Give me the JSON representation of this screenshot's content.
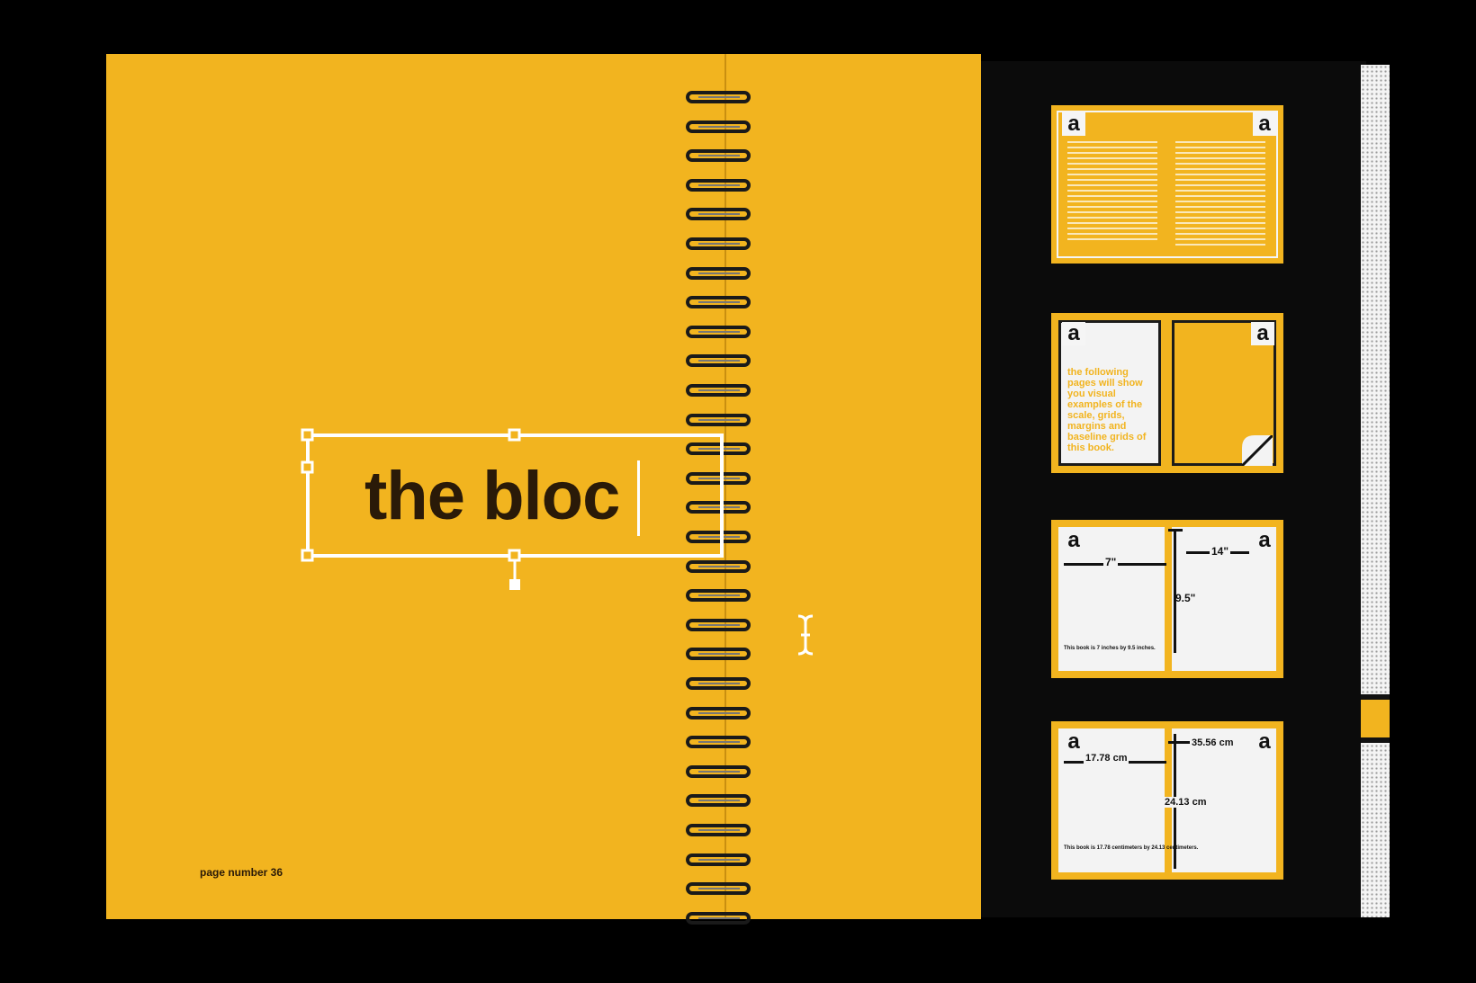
{
  "left_page": {
    "heading": "the bloc",
    "page_number": "page number 36"
  },
  "thumbnails": {
    "corner_letter": "a",
    "thumb2_text": "the following pages will show you visual examples of the scale, grids, margins and baseline grids of this book.",
    "thumb3": {
      "width": "7\"",
      "spread_width": "14\"",
      "height": "9.5\"",
      "caption": "This book is 7 inches by 9.5 inches."
    },
    "thumb4": {
      "width": "17.78 cm",
      "spread_width": "35.56 cm",
      "height": "24.13 cm",
      "caption": "This book is 17.78 centimeters by 24.13 centimeters."
    }
  },
  "colors": {
    "page_yellow": "#f2b41f",
    "ink": "#2a1a08",
    "background": "#000000"
  }
}
